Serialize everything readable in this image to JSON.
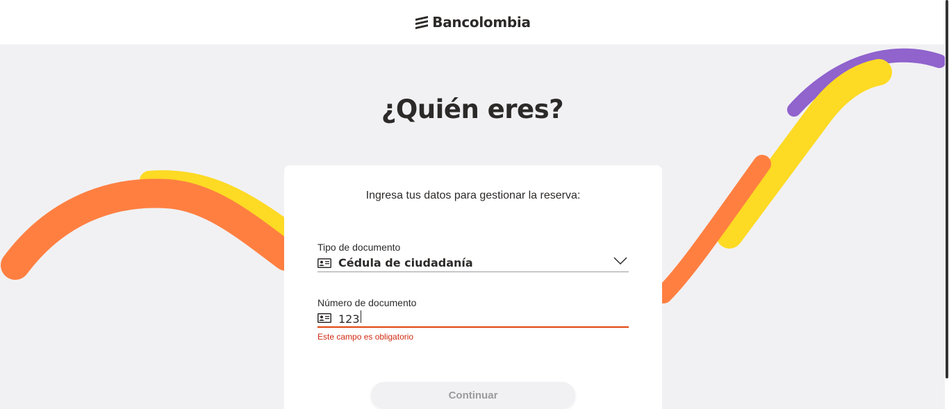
{
  "header": {
    "brand_name": "Bancolombia",
    "logo_icon": "bancolombia-logo-icon"
  },
  "page": {
    "title": "¿Quién eres?"
  },
  "form": {
    "subtitle": "Ingresa tus datos para gestionar la reserva:",
    "document_type": {
      "label": "Tipo de documento",
      "value": "Cédula de ciudadanía",
      "icon": "id-card-icon"
    },
    "document_number": {
      "label": "Número de documento",
      "value": "123",
      "icon": "id-card-icon",
      "error": "Este campo es obligatorio"
    },
    "continue_label": "Continuar"
  },
  "colors": {
    "orange": "#ff7f41",
    "yellow": "#fdda24",
    "purple": "#9063cd",
    "error": "#d12a12",
    "background": "#f1f1f3"
  }
}
